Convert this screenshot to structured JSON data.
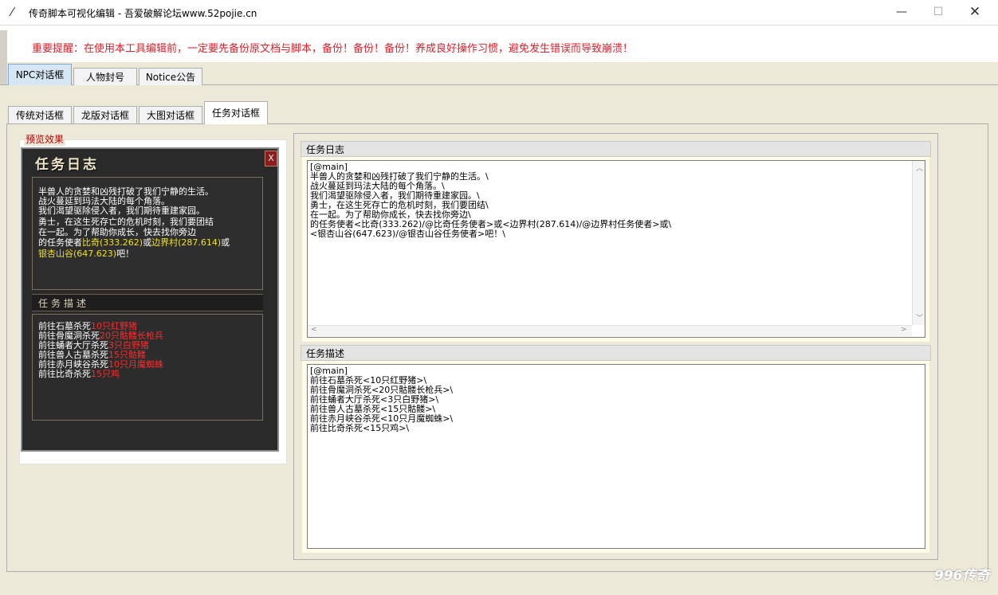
{
  "window": {
    "title": "传奇脚本可视化编辑 - 吾爱破解论坛www.52pojie.cn",
    "minimize": "—",
    "maximize": "☐",
    "close": "✕"
  },
  "warning": "重要提醒：在使用本工具编辑前，一定要先备份原文档与脚本，备份！备份！备份！养成良好操作习惯，避免发生错误而导致崩溃！",
  "main_tabs": [
    "NPC对话框",
    "人物封号",
    "Notice公告"
  ],
  "sub_tabs": [
    "传统对话框",
    "龙版对话框",
    "大图对话框",
    "任务对话框"
  ],
  "preview": {
    "label": "预览效果",
    "game_title": "任务日志",
    "close_glyph": "X",
    "log_lines": [
      "半兽人的贪婪和凶残打破了我们宁静的生活。",
      "战火蔓延到玛法大陆的每个角落。",
      "我们渴望驱除侵入者，我们期待重建家园。",
      "勇士，在这生死存亡的危机时刻，我们要团结",
      "在一起。为了帮助你成长，快去找你旁边"
    ],
    "log_line6": {
      "pre": "的任务使者",
      "a": "比奇(333.262)",
      "mid": "或",
      "b": "边界村(287.614)",
      "post": "或"
    },
    "log_line7": {
      "a": "银杏山谷(647.623)",
      "post": "吧！"
    },
    "desc_title": "任务描述",
    "desc_lines": [
      {
        "pre": "前往石墓杀死",
        "hl": "10只红野猪"
      },
      {
        "pre": "前往骨魔洞杀死",
        "hl": "20只骷髅长枪兵"
      },
      {
        "pre": "前往蛹者大厅杀死",
        "hl": "3只白野猪"
      },
      {
        "pre": "前往兽人古墓杀死",
        "hl": "15只骷髅"
      },
      {
        "pre": "前往赤月峡谷杀死",
        "hl": "10只月魔蜘蛛"
      },
      {
        "pre": "前往比奇杀死",
        "hl": "15只鸡"
      }
    ]
  },
  "editor": {
    "log_header": "任务日志",
    "log_text": "[@main]\n半兽人的贪婪和凶残打破了我们宁静的生活。\\\n战火蔓延到玛法大陆的每个角落。\\\n我们渴望驱除侵入者，我们期待重建家园。\\\n勇士，在这生死存亡的危机时刻，我们要团结\\\n在一起。为了帮助你成长，快去找你旁边\\\n的任务使者<比奇(333.262)/@比奇任务使者>或<边界村(287.614)/@边界村任务使者>或\\\n<银杏山谷(647.623)/@银杏山谷任务使者>吧！\\",
    "desc_header": "任务描述",
    "desc_text": "[@main]\n前往石墓杀死<10只红野猪>\\\n前往骨魔洞杀死<20只骷髅长枪兵>\\\n前往蛹者大厅杀死<3只白野猪>\\\n前往兽人古墓杀死<15只骷髅>\\\n前往赤月峡谷杀死<10只月魔蜘蛛>\\\n前往比奇杀死<15只鸡>\\"
  },
  "watermark": "996传奇"
}
